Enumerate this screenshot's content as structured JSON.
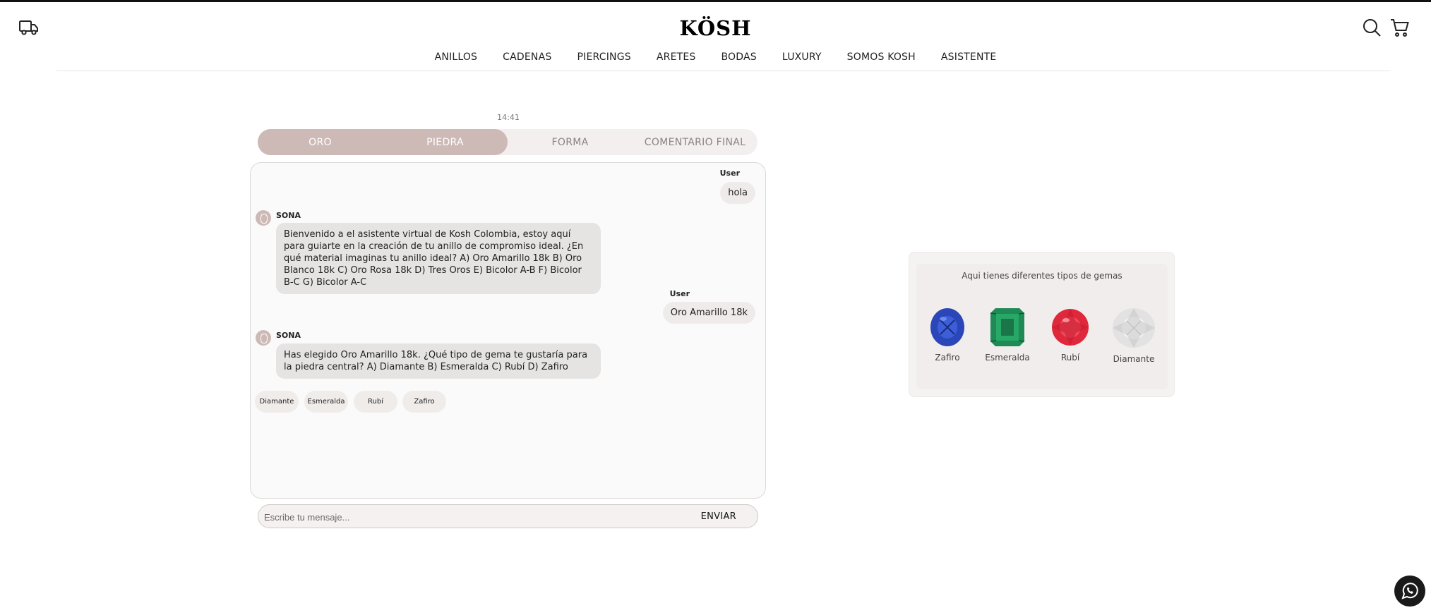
{
  "brand": {
    "logo": "KÖSH"
  },
  "header": {
    "icons": [
      "truck-icon",
      "search-icon",
      "cart-icon"
    ]
  },
  "nav": [
    "ANILLOS",
    "CADENAS",
    "PIERCINGS",
    "ARETES",
    "BODAS",
    "LUXURY",
    "SOMOS KOSH",
    "ASISTENTE"
  ],
  "chat": {
    "timestamp": "14:41",
    "steps": [
      {
        "label": "ORO",
        "done": true
      },
      {
        "label": "PIEDRA",
        "done": true
      },
      {
        "label": "FORMA",
        "done": false
      },
      {
        "label": "COMENTARIO FINAL",
        "done": false
      }
    ],
    "progress_percent": 50,
    "messages": [
      {
        "sender": "User",
        "text": "hola"
      },
      {
        "sender": "SONA",
        "text": "Bienvenido a el asistente virtual de Kosh Colombia, estoy aquí para guiarte en la creación de tu anillo de compromiso ideal. ¿En qué material imaginas tu anillo ideal? A) Oro Amarillo 18k B) Oro Blanco 18k C) Oro Rosa 18k D) Tres Oros E) Bicolor A-B F) Bicolor B-C G) Bicolor A-C"
      },
      {
        "sender": "User",
        "text": "Oro Amarillo 18k"
      },
      {
        "sender": "SONA",
        "text": "Has elegido Oro Amarillo 18k. ¿Qué tipo de gema te gustaría para la piedra central? A) Diamante B) Esmeralda C) Rubí D) Zafiro"
      }
    ],
    "quick_replies": [
      "Diamante",
      "Esmeralda",
      "Rubí",
      "Zafiro"
    ],
    "input_placeholder": "Escribe tu mensaje...",
    "send_label": "ENVIAR"
  },
  "gems_panel": {
    "title": "Aqui tienes diferentes tipos de gemas",
    "gems": [
      {
        "name": "Zafiro",
        "color": "#2a46b8"
      },
      {
        "name": "Esmeralda",
        "color": "#1f8a55"
      },
      {
        "name": "Rubí",
        "color": "#e0283c"
      },
      {
        "name": "Diamante",
        "color": "#d9d9d9"
      }
    ]
  }
}
